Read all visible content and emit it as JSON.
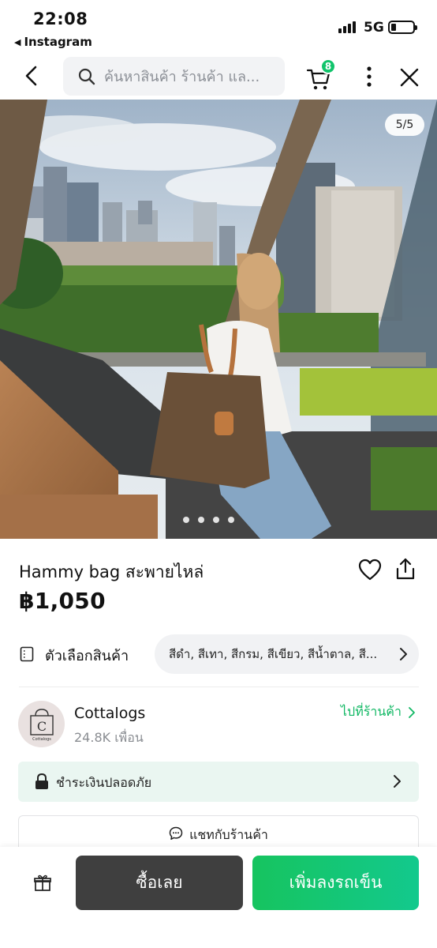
{
  "status_bar": {
    "time": "22:08",
    "back_app_label": "Instagram",
    "network": "5G"
  },
  "navbar": {
    "search_placeholder": "ค้นหาสินค้า ร้านค้า แล...",
    "cart_count": "8",
    "accent_color": "#11c46b"
  },
  "gallery": {
    "counter": "5/5",
    "dot_count": 4
  },
  "product": {
    "title": "Hammy bag สะพายไหล่",
    "price": "฿1,050"
  },
  "options": {
    "label": "ตัวเลือกสินค้า",
    "value": "สีดำ, สีเทา, สีกรม, สีเขียว, สีน้ำตาล, สี..."
  },
  "shop": {
    "name": "Cottalogs",
    "followers": "24.8K เพื่อน",
    "goto_label": "ไปที่ร้านค้า",
    "logo_letter": "C",
    "logo_caption": "Cottalogs"
  },
  "secure_payment": {
    "label": "ชำระเงินปลอดภัย"
  },
  "chat": {
    "label": "แชทกับร้านค้า"
  },
  "bottom_bar": {
    "buy_now_label": "ซื้อเลย",
    "add_to_cart_label": "เพิ่มลงรถเข็น"
  }
}
